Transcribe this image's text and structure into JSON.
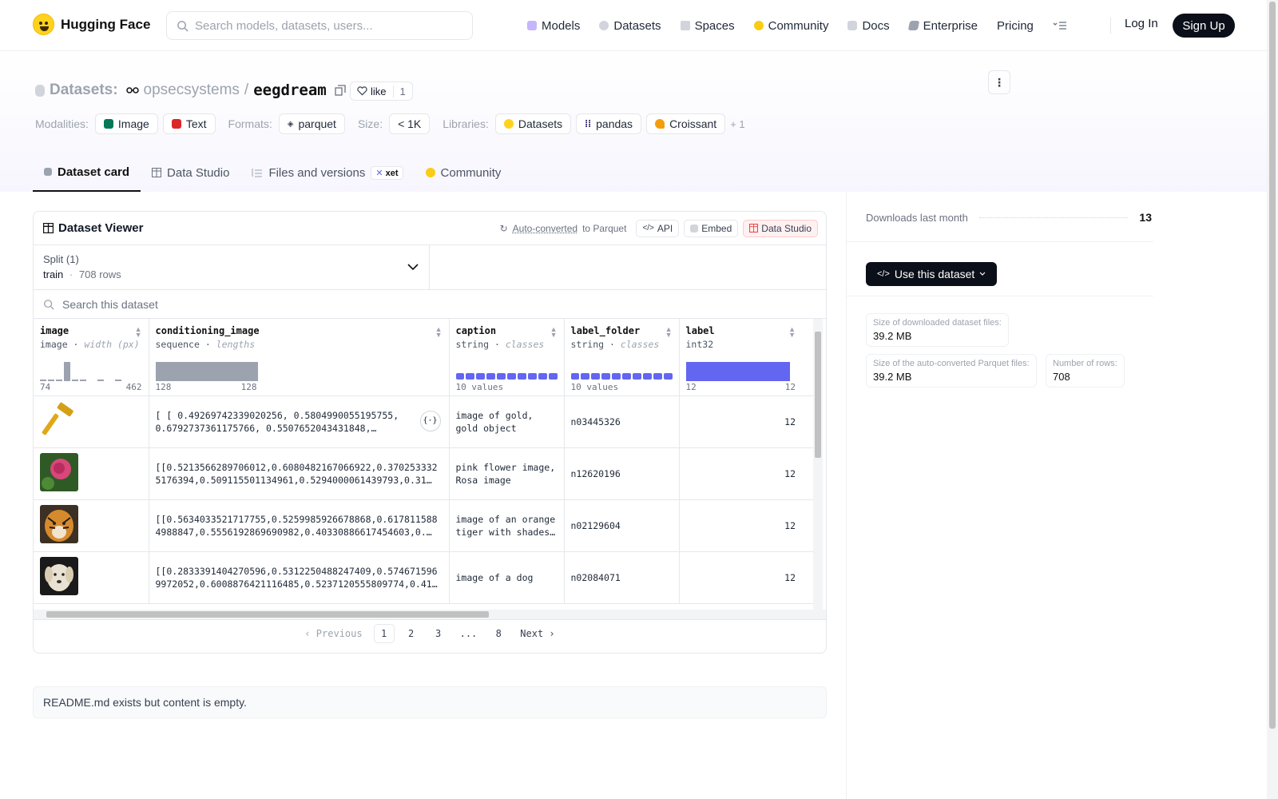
{
  "nav": {
    "brand": "Hugging Face",
    "search_placeholder": "Search models, datasets, users...",
    "items": [
      {
        "label": "Models",
        "icon": "models-icon",
        "color": "#a78bfa"
      },
      {
        "label": "Datasets",
        "icon": "datasets-icon",
        "color": "#ef4444"
      },
      {
        "label": "Spaces",
        "icon": "spaces-icon",
        "color": "#3b82f6"
      },
      {
        "label": "Community",
        "icon": "community-icon",
        "color": "#facc15"
      },
      {
        "label": "Docs",
        "icon": "docs-icon",
        "color": "#9ca3af"
      },
      {
        "label": "Enterprise",
        "icon": "enterprise-icon",
        "color": "#6b7280"
      },
      {
        "label": "Pricing",
        "icon": "",
        "color": ""
      }
    ],
    "login": "Log In",
    "signup": "Sign Up"
  },
  "header": {
    "section": "Datasets:",
    "org": "opsecsystems",
    "separator": "/",
    "name": "eegdream",
    "like_label": "like",
    "like_count": "1",
    "tags": {
      "modalities_label": "Modalities:",
      "modalities": [
        "Image",
        "Text"
      ],
      "formats_label": "Formats:",
      "formats": [
        "parquet"
      ],
      "size_label": "Size:",
      "size": "< 1K",
      "libraries_label": "Libraries:",
      "libraries": [
        "Datasets",
        "pandas",
        "Croissant"
      ],
      "more": "+ 1"
    },
    "tabs": [
      "Dataset card",
      "Data Studio",
      "Files and versions",
      "Community"
    ],
    "xet_badge": "xet"
  },
  "viewer": {
    "title": "Dataset Viewer",
    "auto_converted": "Auto-converted",
    "to_parquet": "to Parquet",
    "api": "API",
    "embed": "Embed",
    "data_studio": "Data Studio",
    "split_label": "Split (1)",
    "split_name": "train",
    "split_dot": "·",
    "split_rows": "708 rows",
    "search_placeholder": "Search this dataset",
    "columns": [
      {
        "name": "image",
        "type": "image",
        "stat": "width (px)",
        "min": "74",
        "max": "462"
      },
      {
        "name": "conditioning_image",
        "type": "sequence",
        "stat": "lengths",
        "min": "128",
        "max": "128"
      },
      {
        "name": "caption",
        "type": "string",
        "stat": "classes",
        "summary": "10 values"
      },
      {
        "name": "label_folder",
        "type": "string",
        "stat": "classes",
        "summary": "10 values"
      },
      {
        "name": "label",
        "type": "int32",
        "stat": "",
        "min": "12",
        "max": "12"
      }
    ],
    "rows": [
      {
        "image": "razor-thumbnail",
        "conditioning_image": "[ [ 0.49269742339020256, 0.5804990055195755, 0.6792737361175766, 0.5507652043431848,…",
        "caption": "image of gold, gold object",
        "label_folder": "n03445326",
        "label": "12"
      },
      {
        "image": "rose-thumbnail",
        "conditioning_image": "[[0.5213566289706012,0.6080482167066922,0.3702533325176394,0.509115501134961,0.5294000061439793,0.31",
        "caption": "pink flower image, Rosa image",
        "label_folder": "n12620196",
        "label": "12"
      },
      {
        "image": "tiger-thumbnail",
        "conditioning_image": "[[0.5634033521717755,0.5259985926678868,0.6178115884988847,0.5556192869690982,0.40330886617454603,0.…",
        "caption": "image of an orange tiger with shades…",
        "label_folder": "n02129604",
        "label": "12"
      },
      {
        "image": "dog-thumbnail",
        "conditioning_image": "[[0.2833391404270596,0.5312250488247409,0.5746715969972052,0.6008876421116485,0.5237120555809774,0.41",
        "caption": "image of a dog",
        "label_folder": "n02084071",
        "label": "12"
      }
    ],
    "ellipsis_marker": "(...",
    "pager": {
      "prev": "Previous",
      "pages": [
        "1",
        "2",
        "3",
        "...",
        "8"
      ],
      "next": "Next"
    }
  },
  "readme": "README.md exists but content is empty.",
  "sidebar": {
    "downloads_label": "Downloads last month",
    "downloads_value": "13",
    "use_button": "Use this dataset",
    "stats": [
      {
        "label": "Size of downloaded dataset files:",
        "value": "39.2 MB"
      },
      {
        "label": "Size of the auto-converted Parquet files:",
        "value": "39.2 MB"
      },
      {
        "label": "Number of rows:",
        "value": "708"
      }
    ]
  }
}
